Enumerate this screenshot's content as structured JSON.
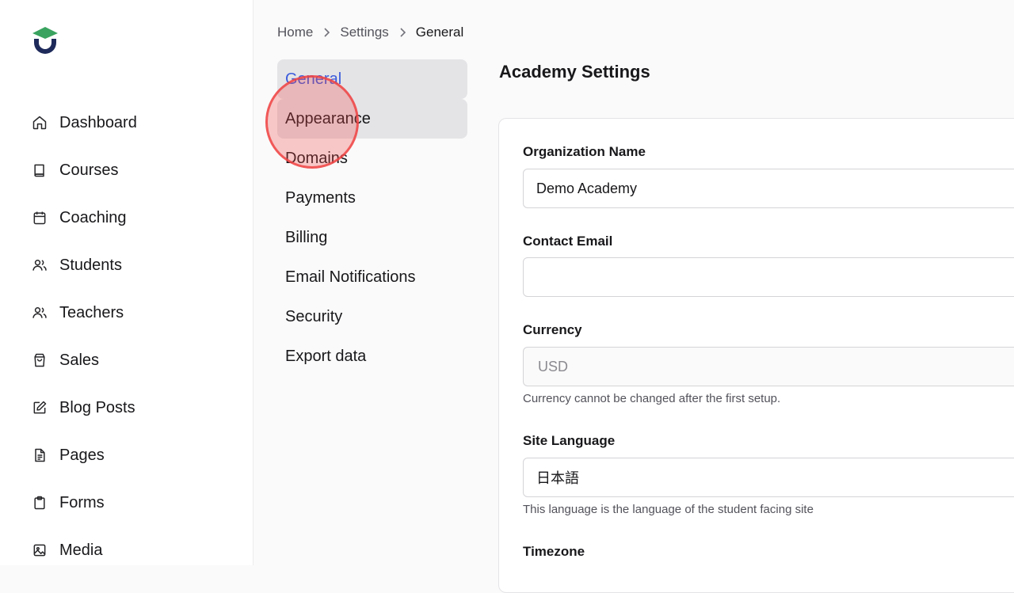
{
  "logo": {
    "icon": "graduation-cap-logo",
    "colors": {
      "cap": "#3aa35f",
      "ring": "#1e2a5a"
    }
  },
  "sidebar": {
    "items": [
      {
        "label": "Dashboard",
        "icon": "home-icon"
      },
      {
        "label": "Courses",
        "icon": "book-icon"
      },
      {
        "label": "Coaching",
        "icon": "calendar-icon"
      },
      {
        "label": "Students",
        "icon": "users-icon"
      },
      {
        "label": "Teachers",
        "icon": "users-icon"
      },
      {
        "label": "Sales",
        "icon": "shopping-bag-icon"
      },
      {
        "label": "Blog Posts",
        "icon": "edit-icon"
      },
      {
        "label": "Pages",
        "icon": "document-icon"
      },
      {
        "label": "Forms",
        "icon": "clipboard-icon"
      },
      {
        "label": "Media",
        "icon": "image-icon"
      }
    ]
  },
  "breadcrumb": {
    "home": "Home",
    "settings": "Settings",
    "current": "General"
  },
  "subnav": {
    "items": [
      {
        "label": "General",
        "state": "active"
      },
      {
        "label": "Appearance",
        "state": "hover"
      },
      {
        "label": "Domains"
      },
      {
        "label": "Payments"
      },
      {
        "label": "Billing"
      },
      {
        "label": "Email Notifications"
      },
      {
        "label": "Security"
      },
      {
        "label": "Export data"
      }
    ]
  },
  "main": {
    "title": "Academy Settings",
    "org_name": {
      "label": "Organization Name",
      "value": "Demo Academy"
    },
    "contact_email": {
      "label": "Contact Email",
      "value": ""
    },
    "currency": {
      "label": "Currency",
      "value": "USD",
      "help": "Currency cannot be changed after the first setup."
    },
    "site_language": {
      "label": "Site Language",
      "value": "日本語",
      "help": "This language is the language of the student facing site"
    },
    "timezone": {
      "label": "Timezone"
    }
  },
  "colors": {
    "accent": "#3b5bdb",
    "active_bg": "#e4e4e7",
    "click_indicator": "#ef4444"
  }
}
